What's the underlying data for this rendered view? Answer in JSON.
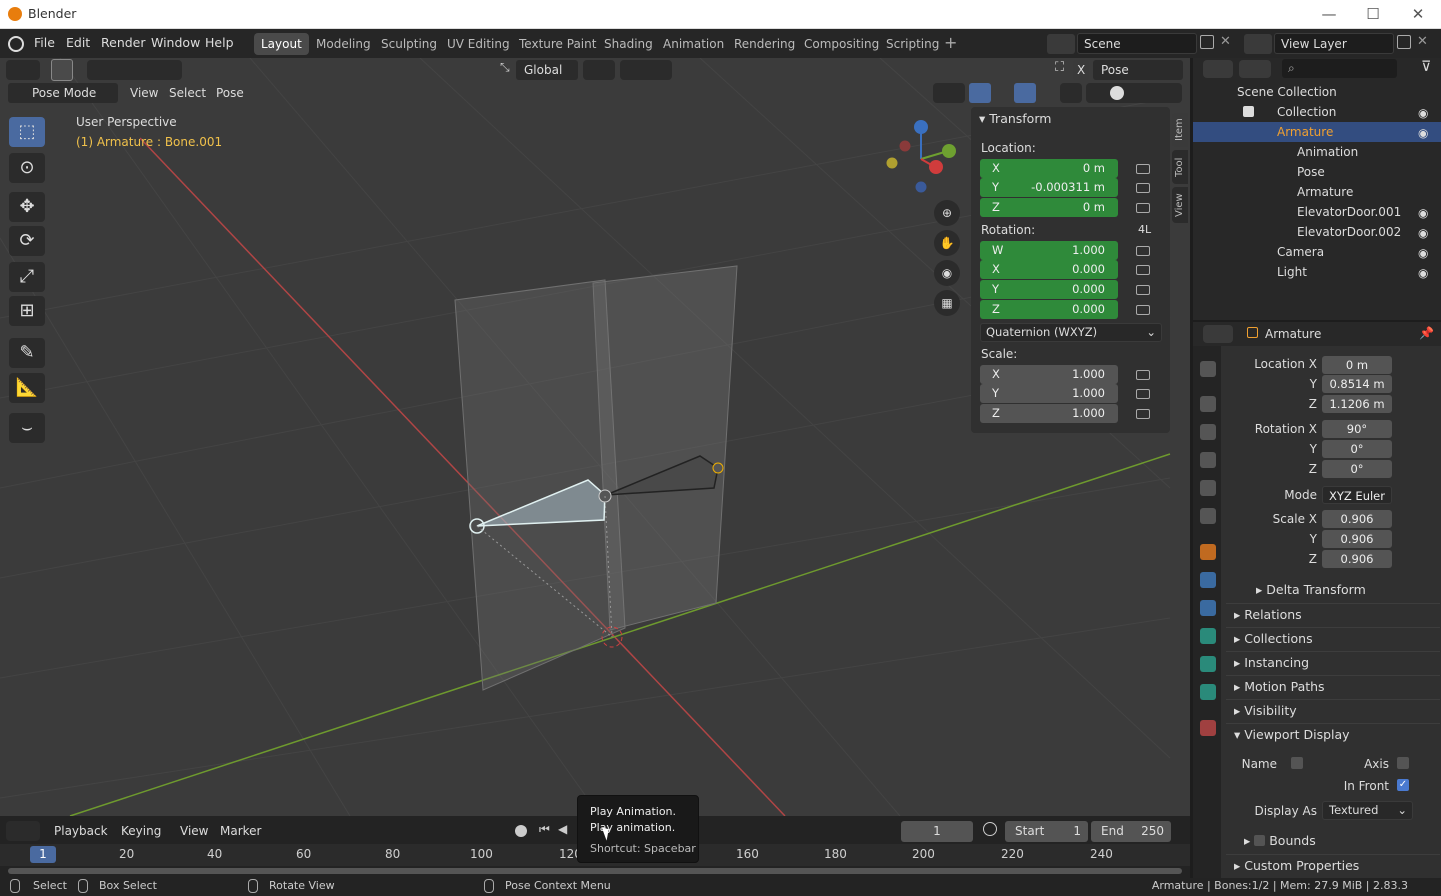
{
  "window": {
    "title": "Blender",
    "min_glyph": "—",
    "max_glyph": "☐",
    "close_glyph": "✕"
  },
  "menu": [
    "File",
    "Edit",
    "Render",
    "Window",
    "Help"
  ],
  "workspace_tabs": [
    "Layout",
    "Modeling",
    "Sculpting",
    "UV Editing",
    "Texture Paint",
    "Shading",
    "Animation",
    "Rendering",
    "Compositing",
    "Scripting"
  ],
  "scene": "Scene",
  "view_layer": "View Layer",
  "viewport_header": {
    "orientation": "Global",
    "pose_options": "Pose Options",
    "mode": "Pose Mode",
    "menus": [
      "View",
      "Select",
      "Pose"
    ],
    "x_label": "X"
  },
  "viewport": {
    "perspective": "User Perspective",
    "active": "(1) Armature : Bone.001"
  },
  "npanel": {
    "header": "Transform",
    "location_label": "Location:",
    "location": [
      {
        "axis": "X",
        "value": "0 m"
      },
      {
        "axis": "Y",
        "value": "-0.000311 m"
      },
      {
        "axis": "Z",
        "value": "0 m"
      }
    ],
    "rotation_label": "Rotation:",
    "rotation_extra": "4L",
    "rotation": [
      {
        "axis": "W",
        "value": "1.000"
      },
      {
        "axis": "X",
        "value": "0.000"
      },
      {
        "axis": "Y",
        "value": "0.000"
      },
      {
        "axis": "Z",
        "value": "0.000"
      }
    ],
    "rotation_mode": "Quaternion (WXYZ)",
    "scale_label": "Scale:",
    "scale": [
      {
        "axis": "X",
        "value": "1.000"
      },
      {
        "axis": "Y",
        "value": "1.000"
      },
      {
        "axis": "Z",
        "value": "1.000"
      }
    ],
    "tabs": [
      "Item",
      "Tool",
      "View"
    ]
  },
  "outliner": {
    "rows": [
      "Scene Collection",
      "Collection",
      "Armature",
      "Animation",
      "Pose",
      "Armature",
      "ElevatorDoor.001",
      "ElevatorDoor.002",
      "Camera",
      "Light"
    ]
  },
  "properties": {
    "object_name": "Armature",
    "location_label": "Location X",
    "location": [
      "0 m",
      "0.8514 m",
      "1.1206 m"
    ],
    "rotation_label": "Rotation X",
    "rotation": [
      "90°",
      "0°",
      "0°"
    ],
    "mode_label": "Mode",
    "mode": "XYZ Euler",
    "scale_label": "Scale X",
    "scale": [
      "0.906",
      "0.906",
      "0.906"
    ],
    "y": "Y",
    "z": "Z",
    "sections": [
      "Delta Transform",
      "Relations",
      "Collections",
      "Instancing",
      "Motion Paths",
      "Visibility",
      "Viewport Display"
    ],
    "vd_name": "Name",
    "vd_axis": "Axis",
    "vd_in_front": "In Front",
    "vd_display_as_label": "Display As",
    "vd_display_as": "Textured",
    "vd_bounds": "Bounds",
    "custom_properties": "Custom Properties"
  },
  "timeline": {
    "menus": [
      "Playback",
      "Keying",
      "View",
      "Marker"
    ],
    "current_frame": "1",
    "start_label": "Start",
    "start": "1",
    "end_label": "End",
    "end": "250",
    "ticks": [
      "1",
      "20",
      "40",
      "60",
      "80",
      "100",
      "120",
      "160",
      "180",
      "200",
      "220",
      "240"
    ]
  },
  "tooltip": {
    "title": "Play Animation.",
    "desc": "Play animation.",
    "shortcut": "Shortcut: Spacebar"
  },
  "statusbar": {
    "select": "Select",
    "box_select": "Box Select",
    "rotate_view": "Rotate View",
    "context_menu": "Pose Context Menu",
    "info": "Armature | Bones:1/2 | Mem: 27.9 MiB | 2.83.3"
  },
  "colors": {
    "accent": "#334d80",
    "field_green": "#2f8a3a",
    "active_text": "#f0c14b"
  }
}
